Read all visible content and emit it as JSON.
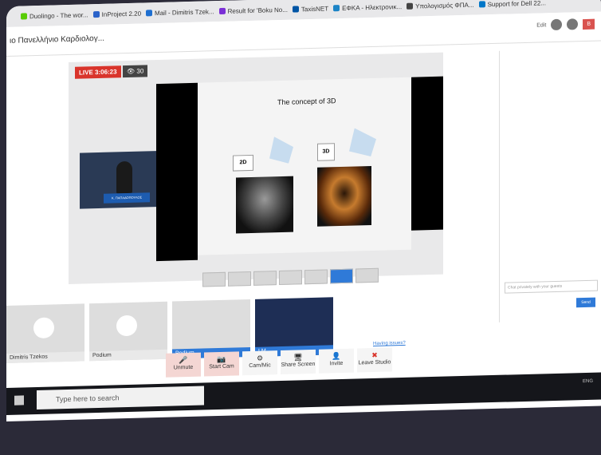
{
  "bookmarks": [
    {
      "label": "Duolingo - The wor...",
      "color": "#58cc02"
    },
    {
      "label": "InProject 2.20",
      "color": "#2a62c9"
    },
    {
      "label": "Mail - Dimitris Tzek...",
      "color": "#1e6fd0"
    },
    {
      "label": "Result for 'Boku No...",
      "color": "#7b2fd6"
    },
    {
      "label": "TaxisNET",
      "color": "#0055a5"
    },
    {
      "label": "ΕΦΚΑ - Ηλεκτρονικ...",
      "color": "#1c84c6"
    },
    {
      "label": "Υπολογισμός ΦΠΑ...",
      "color": "#444444"
    },
    {
      "label": "Support for Dell 22...",
      "color": "#0077c8"
    }
  ],
  "page_title": "ιο Πανελλήνιο Καρδιολογ...",
  "toolbar": {
    "edit_label": "Edit"
  },
  "stream": {
    "live_label": "LIVE 3:06:23",
    "viewer_count": "30",
    "presenter_banner": "Κ. ΠΑΠΑΔΟΠΟΥΛΟΣ"
  },
  "slide": {
    "title": "The concept of 3D",
    "label_2d": "2D",
    "label_3d": "3D"
  },
  "chat": {
    "placeholder": "Chat privately with your guests",
    "send_label": "Send"
  },
  "tiles": [
    {
      "label": "Dimitris Tzekos"
    },
    {
      "label": "Podium"
    },
    {
      "label": "Podium"
    },
    {
      "label": "LM"
    }
  ],
  "controls": [
    {
      "label": "Unmute",
      "glyph": "🎤"
    },
    {
      "label": "Start Cam",
      "glyph": "📷"
    },
    {
      "label": "Cam/Mic",
      "glyph": "⚙"
    },
    {
      "label": "Share Screen",
      "glyph": "🖥"
    },
    {
      "label": "Invite",
      "glyph": "👤"
    },
    {
      "label": "Leave Studio",
      "glyph": "✖"
    }
  ],
  "help_link": "Having issues?",
  "taskbar": {
    "search_placeholder": "Type here to search"
  }
}
